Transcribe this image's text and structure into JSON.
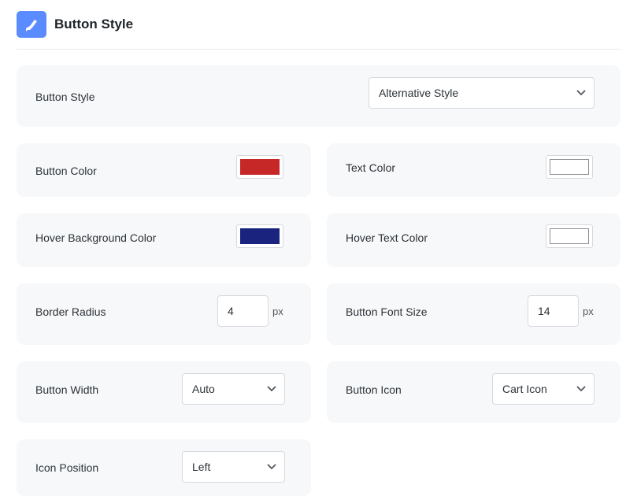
{
  "header": {
    "title": "Button Style",
    "icon": "brush-icon"
  },
  "button_style": {
    "label": "Button Style",
    "value": "Alternative Style"
  },
  "button_color": {
    "label": "Button Color",
    "color": "#c62828"
  },
  "text_color": {
    "label": "Text Color",
    "color": "#ffffff"
  },
  "hover_bg_color": {
    "label": "Hover Background Color",
    "color": "#1a237e"
  },
  "hover_text_color": {
    "label": "Hover Text Color",
    "color": "#ffffff"
  },
  "border_radius": {
    "label": "Border Radius",
    "value": "4",
    "unit": "px"
  },
  "font_size": {
    "label": "Button Font Size",
    "value": "14",
    "unit": "px"
  },
  "button_width": {
    "label": "Button Width",
    "value": "Auto"
  },
  "button_icon": {
    "label": "Button Icon",
    "value": "Cart Icon"
  },
  "icon_position": {
    "label": "Icon Position",
    "value": "Left"
  }
}
